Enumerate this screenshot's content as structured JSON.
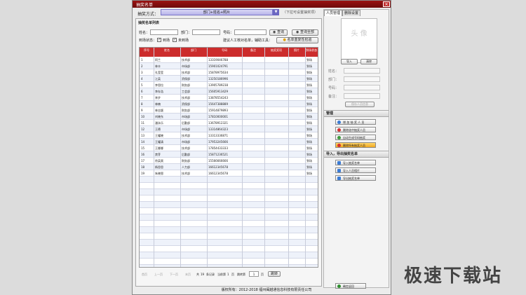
{
  "window": {
    "title": "抽奖名单",
    "close_glyph": "✕"
  },
  "mode": {
    "label": "抽奖方式：",
    "value": "部门+姓名+照片",
    "hint": "（下拉可设置抽奖项）"
  },
  "list_panel": {
    "title": "抽奖名单列表",
    "name_label": "姓名：",
    "dept_label": "部门：",
    "number_label": "号码：",
    "query_btn": "查询",
    "query_all_btn": "查询全部",
    "status_label": "到场状态：",
    "arrived_label": "到场",
    "not_arrived_label": "未到场",
    "tip": "建议人工核对名单，辅助工具：",
    "dup_check_btn": "名单重复性检验"
  },
  "table": {
    "columns": [
      "序号",
      "姓名",
      "部门",
      "号码",
      "备注",
      "抽奖奖项",
      "照片",
      "到场状态"
    ],
    "rows": [
      [
        "1",
        "阿兰",
        "技术部",
        "13319046788",
        "",
        "",
        "",
        "到场"
      ],
      [
        "2",
        "林丰",
        "市场部",
        "15901024791",
        "",
        "",
        "",
        "到场"
      ],
      [
        "3",
        "孔莹莹",
        "技术部",
        "15878975634",
        "",
        "",
        "",
        "到场"
      ],
      [
        "4",
        "江英",
        "资保部",
        "13250186996",
        "",
        "",
        "",
        "到场"
      ],
      [
        "5",
        "李思拉",
        "财务部",
        "13905789238",
        "",
        "",
        "",
        "到场"
      ],
      [
        "6",
        "李存浩",
        "工会部",
        "15605913429",
        "",
        "",
        "",
        "到场"
      ],
      [
        "7",
        "李步",
        "技术部",
        "13878554243",
        "",
        "",
        "",
        "到场"
      ],
      [
        "8",
        "林楠",
        "资保部",
        "15647388889",
        "",
        "",
        "",
        "到场"
      ],
      [
        "9",
        "林志颖",
        "财务部",
        "15914879893",
        "",
        "",
        "",
        "到场"
      ],
      [
        "10",
        "刘晓东",
        "市场部",
        "17810000001",
        "",
        "",
        "",
        "到场"
      ],
      [
        "11",
        "潘永乐",
        "后勤部",
        "13678912321",
        "",
        "",
        "",
        "到场"
      ],
      [
        "12",
        "王德",
        "市场部",
        "13314864323",
        "",
        "",
        "",
        "到场"
      ],
      [
        "13",
        "王耀晓",
        "技术部",
        "13313336871",
        "",
        "",
        "",
        "到场"
      ],
      [
        "14",
        "王耀清",
        "市场部",
        "17953245666",
        "",
        "",
        "",
        "到场"
      ],
      [
        "15",
        "王娜娜",
        "技术部",
        "17854433333",
        "",
        "",
        "",
        "到场"
      ],
      [
        "16",
        "禁芽",
        "后勤部",
        "15871236521",
        "",
        "",
        "",
        "到场"
      ],
      [
        "17",
        "徐英寅",
        "财务部",
        "15566666666",
        "",
        "",
        "",
        "到场"
      ],
      [
        "18",
        "杨思思",
        "人力部",
        "16612345678",
        "",
        "",
        "",
        "到场"
      ],
      [
        "19",
        "朱晓恩",
        "技术部",
        "16612345678",
        "",
        "",
        "",
        "到场"
      ]
    ]
  },
  "pager": {
    "first": "首页",
    "prev": "上一页",
    "next": "下一页",
    "last": "末页",
    "total_prefix": "共",
    "total": "19",
    "total_suffix": "条记录",
    "current_prefix": "当前第",
    "current": "1",
    "current_suffix": "页",
    "goto_prefix": "跳转第",
    "goto_value": "1",
    "goto_suffix": "页",
    "goto_btn": "跳转"
  },
  "right_panel": {
    "tabs": [
      "人员管理",
      "删除设置"
    ],
    "photo_placeholder": "头 像",
    "import_btn": "导入",
    "delete_btn": "清除",
    "fields": [
      "姓名：",
      "部门：",
      "号码：",
      "备注："
    ],
    "save_person_btn": "保存人员信息",
    "manage_header": "管理",
    "manage_buttons": [
      "增 加 抽 奖 人 员",
      "删除选中抽奖人员",
      "自动生成号码抽奖",
      "删除所有抽奖人员"
    ],
    "io_header": "导入，导出抽奖名单",
    "io_buttons": [
      "导入抽奖名单",
      "导入人员相片",
      "导出抽奖名单"
    ],
    "confirm_btn": "确定返回"
  },
  "footer": {
    "text": "版权所有：2012-2018 福州闽越通信息科技有限责任公司"
  },
  "watermark": "极速下载站",
  "colors": {
    "header_red": "#cc2c2c",
    "title_red": "#8a1010"
  }
}
